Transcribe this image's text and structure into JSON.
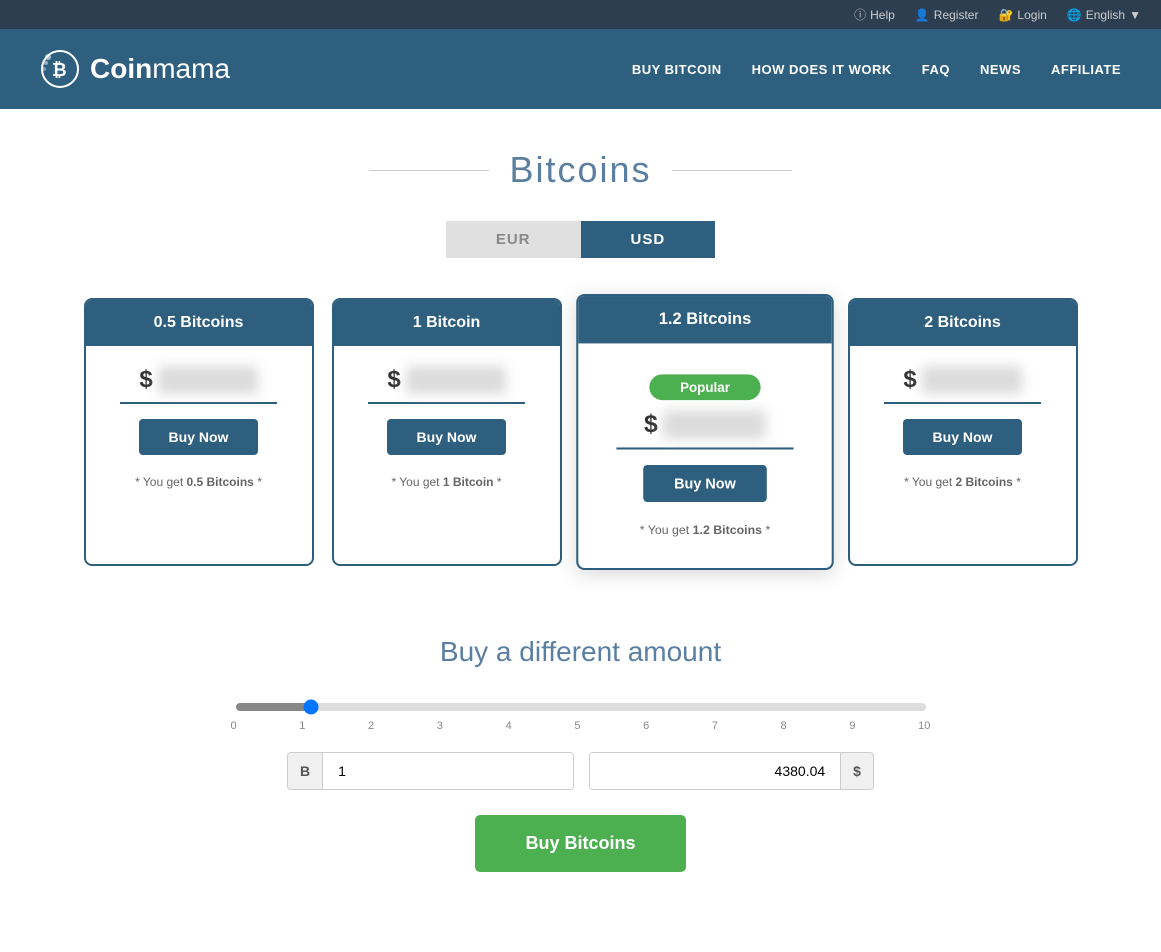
{
  "topbar": {
    "help_label": "Help",
    "register_label": "Register",
    "login_label": "Login",
    "language_label": "English"
  },
  "header": {
    "logo_text_coin": "Coin",
    "logo_text_mama": "mama",
    "nav": {
      "buy_bitcoin": "BUY BITCOIN",
      "how_it_works": "HOW DOES IT WORK",
      "faq": "FAQ",
      "news": "NEWS",
      "affiliate": "AFFILIATE"
    }
  },
  "page": {
    "title": "Bitcoins",
    "currency_eur": "EUR",
    "currency_usd": "USD",
    "different_amount_title": "Buy a different amount"
  },
  "cards": [
    {
      "id": "card-0.5",
      "title": "0.5 Bitcoins",
      "price_symbol": "$",
      "price_value": "XXXXXX",
      "buy_label": "Buy Now",
      "footer": "* You get 0.5 Bitcoins *",
      "featured": false
    },
    {
      "id": "card-1",
      "title": "1 Bitcoin",
      "price_symbol": "$",
      "price_value": "XXXXXX",
      "buy_label": "Buy Now",
      "footer": "* You get 1 Bitcoin *",
      "featured": false
    },
    {
      "id": "card-1.2",
      "title": "1.2 Bitcoins",
      "price_symbol": "$",
      "price_value": "XXXXXX",
      "buy_label": "Buy Now",
      "footer": "* You get 1.2 Bitcoins *",
      "featured": true,
      "popular_badge": "Popular"
    },
    {
      "id": "card-2",
      "title": "2 Bitcoins",
      "price_symbol": "$",
      "price_value": "XXXXXX",
      "buy_label": "Buy Now",
      "footer": "* You get 2 Bitcoins *",
      "featured": false
    }
  ],
  "slider": {
    "min": "0",
    "max": "10",
    "labels": [
      "0",
      "1",
      "2",
      "3",
      "4",
      "5",
      "6",
      "7",
      "8",
      "9",
      "10"
    ],
    "value": "1"
  },
  "custom_amount": {
    "btc_prefix": "B",
    "btc_value": "1",
    "usd_value": "4380.04",
    "usd_suffix": "$"
  },
  "buy_button": {
    "label": "Buy Bitcoins"
  }
}
